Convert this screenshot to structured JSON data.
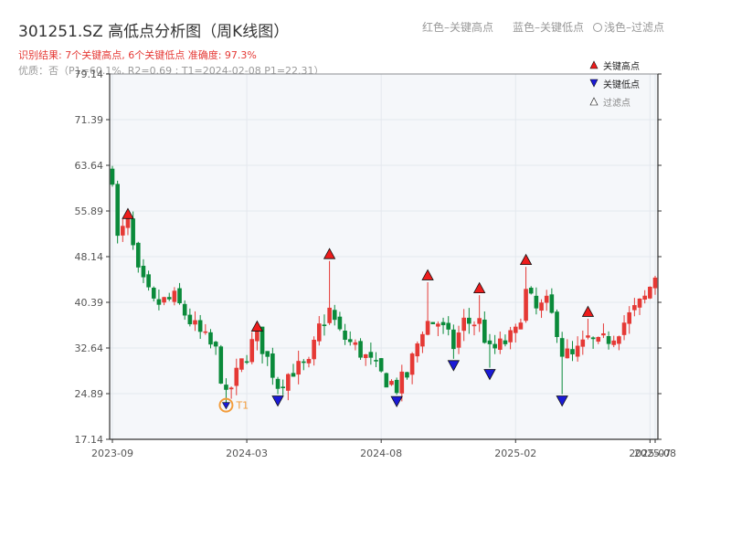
{
  "header": {
    "title": "301251.SZ 高低点分析图（周K线图）",
    "result_line": "识别结果: 7个关键高点, 6个关键低点  准确度: 97.3%",
    "detail_line": "优质：否（P1=60.1%, R2=0.69 ; T1=2024-02-08 P1=22.31）",
    "legend_high": "红色–关键高点",
    "legend_low": "蓝色–关键低点",
    "legend_filtered": "浅色–过滤点"
  },
  "colors": {
    "up": "#e53935",
    "down": "#0a8a3a",
    "high_marker": "#ee1c1c",
    "low_marker": "#1a1ad6",
    "t1": "#f39c3a",
    "plot_bg": "#f5f7fa",
    "grid": "#e4e8ee",
    "axis": "#333333"
  },
  "chart_data": {
    "type": "candlestick",
    "y_ticks": [
      "79.14",
      "71.39",
      "63.64",
      "55.89",
      "48.14",
      "40.39",
      "32.64",
      "24.89",
      "17.14"
    ],
    "ylim": [
      17.14,
      79.14
    ],
    "x_ticks": [
      {
        "label": "2023-09",
        "index": 0
      },
      {
        "label": "2024-03",
        "index": 26
      },
      {
        "label": "2024-08",
        "index": 52
      },
      {
        "label": "2025-02",
        "index": 78
      },
      {
        "label": "2025-07",
        "index": 104
      },
      {
        "label": "2025-08",
        "index": 105
      }
    ],
    "candle_count": 106,
    "key_highs": [
      {
        "index": 3,
        "price": 54.6
      },
      {
        "index": 28,
        "price": 35.5
      },
      {
        "index": 42,
        "price": 47.8
      },
      {
        "index": 61,
        "price": 44.2
      },
      {
        "index": 71,
        "price": 42.0
      },
      {
        "index": 80,
        "price": 46.8
      },
      {
        "index": 92,
        "price": 38.0
      }
    ],
    "key_lows": [
      {
        "index": 32,
        "price": 24.5
      },
      {
        "index": 55,
        "price": 24.4
      },
      {
        "index": 66,
        "price": 30.5
      },
      {
        "index": 73,
        "price": 29.0
      },
      {
        "index": 87,
        "price": 24.5
      }
    ],
    "t1": {
      "label": "T1",
      "date": "2024-02-08",
      "index": 22,
      "price": 22.31
    },
    "legend": [
      "关键高点",
      "关键低点",
      "过滤点"
    ]
  }
}
